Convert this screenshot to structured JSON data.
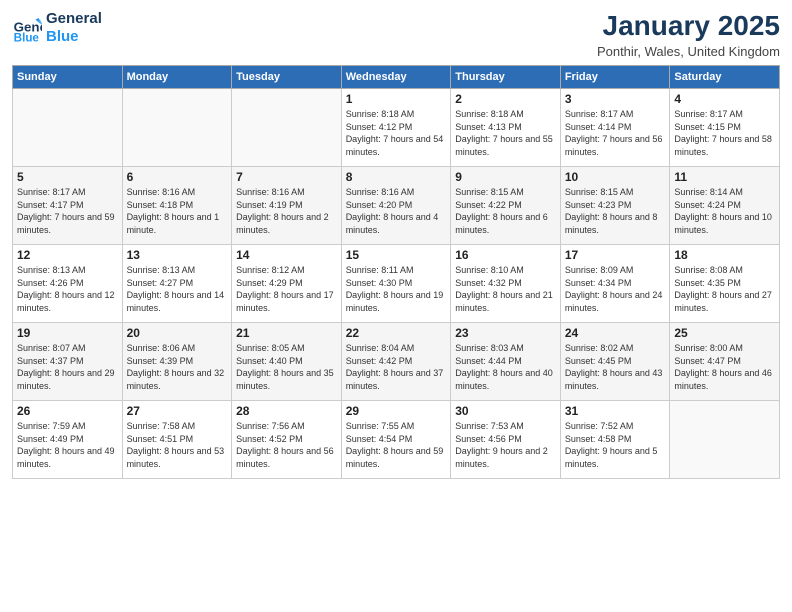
{
  "logo": {
    "line1": "General",
    "line2": "Blue"
  },
  "title": "January 2025",
  "location": "Ponthir, Wales, United Kingdom",
  "days_of_week": [
    "Sunday",
    "Monday",
    "Tuesday",
    "Wednesday",
    "Thursday",
    "Friday",
    "Saturday"
  ],
  "weeks": [
    [
      {
        "day": "",
        "sunrise": "",
        "sunset": "",
        "daylight": ""
      },
      {
        "day": "",
        "sunrise": "",
        "sunset": "",
        "daylight": ""
      },
      {
        "day": "",
        "sunrise": "",
        "sunset": "",
        "daylight": ""
      },
      {
        "day": "1",
        "sunrise": "Sunrise: 8:18 AM",
        "sunset": "Sunset: 4:12 PM",
        "daylight": "Daylight: 7 hours and 54 minutes."
      },
      {
        "day": "2",
        "sunrise": "Sunrise: 8:18 AM",
        "sunset": "Sunset: 4:13 PM",
        "daylight": "Daylight: 7 hours and 55 minutes."
      },
      {
        "day": "3",
        "sunrise": "Sunrise: 8:17 AM",
        "sunset": "Sunset: 4:14 PM",
        "daylight": "Daylight: 7 hours and 56 minutes."
      },
      {
        "day": "4",
        "sunrise": "Sunrise: 8:17 AM",
        "sunset": "Sunset: 4:15 PM",
        "daylight": "Daylight: 7 hours and 58 minutes."
      }
    ],
    [
      {
        "day": "5",
        "sunrise": "Sunrise: 8:17 AM",
        "sunset": "Sunset: 4:17 PM",
        "daylight": "Daylight: 7 hours and 59 minutes."
      },
      {
        "day": "6",
        "sunrise": "Sunrise: 8:16 AM",
        "sunset": "Sunset: 4:18 PM",
        "daylight": "Daylight: 8 hours and 1 minute."
      },
      {
        "day": "7",
        "sunrise": "Sunrise: 8:16 AM",
        "sunset": "Sunset: 4:19 PM",
        "daylight": "Daylight: 8 hours and 2 minutes."
      },
      {
        "day": "8",
        "sunrise": "Sunrise: 8:16 AM",
        "sunset": "Sunset: 4:20 PM",
        "daylight": "Daylight: 8 hours and 4 minutes."
      },
      {
        "day": "9",
        "sunrise": "Sunrise: 8:15 AM",
        "sunset": "Sunset: 4:22 PM",
        "daylight": "Daylight: 8 hours and 6 minutes."
      },
      {
        "day": "10",
        "sunrise": "Sunrise: 8:15 AM",
        "sunset": "Sunset: 4:23 PM",
        "daylight": "Daylight: 8 hours and 8 minutes."
      },
      {
        "day": "11",
        "sunrise": "Sunrise: 8:14 AM",
        "sunset": "Sunset: 4:24 PM",
        "daylight": "Daylight: 8 hours and 10 minutes."
      }
    ],
    [
      {
        "day": "12",
        "sunrise": "Sunrise: 8:13 AM",
        "sunset": "Sunset: 4:26 PM",
        "daylight": "Daylight: 8 hours and 12 minutes."
      },
      {
        "day": "13",
        "sunrise": "Sunrise: 8:13 AM",
        "sunset": "Sunset: 4:27 PM",
        "daylight": "Daylight: 8 hours and 14 minutes."
      },
      {
        "day": "14",
        "sunrise": "Sunrise: 8:12 AM",
        "sunset": "Sunset: 4:29 PM",
        "daylight": "Daylight: 8 hours and 17 minutes."
      },
      {
        "day": "15",
        "sunrise": "Sunrise: 8:11 AM",
        "sunset": "Sunset: 4:30 PM",
        "daylight": "Daylight: 8 hours and 19 minutes."
      },
      {
        "day": "16",
        "sunrise": "Sunrise: 8:10 AM",
        "sunset": "Sunset: 4:32 PM",
        "daylight": "Daylight: 8 hours and 21 minutes."
      },
      {
        "day": "17",
        "sunrise": "Sunrise: 8:09 AM",
        "sunset": "Sunset: 4:34 PM",
        "daylight": "Daylight: 8 hours and 24 minutes."
      },
      {
        "day": "18",
        "sunrise": "Sunrise: 8:08 AM",
        "sunset": "Sunset: 4:35 PM",
        "daylight": "Daylight: 8 hours and 27 minutes."
      }
    ],
    [
      {
        "day": "19",
        "sunrise": "Sunrise: 8:07 AM",
        "sunset": "Sunset: 4:37 PM",
        "daylight": "Daylight: 8 hours and 29 minutes."
      },
      {
        "day": "20",
        "sunrise": "Sunrise: 8:06 AM",
        "sunset": "Sunset: 4:39 PM",
        "daylight": "Daylight: 8 hours and 32 minutes."
      },
      {
        "day": "21",
        "sunrise": "Sunrise: 8:05 AM",
        "sunset": "Sunset: 4:40 PM",
        "daylight": "Daylight: 8 hours and 35 minutes."
      },
      {
        "day": "22",
        "sunrise": "Sunrise: 8:04 AM",
        "sunset": "Sunset: 4:42 PM",
        "daylight": "Daylight: 8 hours and 37 minutes."
      },
      {
        "day": "23",
        "sunrise": "Sunrise: 8:03 AM",
        "sunset": "Sunset: 4:44 PM",
        "daylight": "Daylight: 8 hours and 40 minutes."
      },
      {
        "day": "24",
        "sunrise": "Sunrise: 8:02 AM",
        "sunset": "Sunset: 4:45 PM",
        "daylight": "Daylight: 8 hours and 43 minutes."
      },
      {
        "day": "25",
        "sunrise": "Sunrise: 8:00 AM",
        "sunset": "Sunset: 4:47 PM",
        "daylight": "Daylight: 8 hours and 46 minutes."
      }
    ],
    [
      {
        "day": "26",
        "sunrise": "Sunrise: 7:59 AM",
        "sunset": "Sunset: 4:49 PM",
        "daylight": "Daylight: 8 hours and 49 minutes."
      },
      {
        "day": "27",
        "sunrise": "Sunrise: 7:58 AM",
        "sunset": "Sunset: 4:51 PM",
        "daylight": "Daylight: 8 hours and 53 minutes."
      },
      {
        "day": "28",
        "sunrise": "Sunrise: 7:56 AM",
        "sunset": "Sunset: 4:52 PM",
        "daylight": "Daylight: 8 hours and 56 minutes."
      },
      {
        "day": "29",
        "sunrise": "Sunrise: 7:55 AM",
        "sunset": "Sunset: 4:54 PM",
        "daylight": "Daylight: 8 hours and 59 minutes."
      },
      {
        "day": "30",
        "sunrise": "Sunrise: 7:53 AM",
        "sunset": "Sunset: 4:56 PM",
        "daylight": "Daylight: 9 hours and 2 minutes."
      },
      {
        "day": "31",
        "sunrise": "Sunrise: 7:52 AM",
        "sunset": "Sunset: 4:58 PM",
        "daylight": "Daylight: 9 hours and 5 minutes."
      },
      {
        "day": "",
        "sunrise": "",
        "sunset": "",
        "daylight": ""
      }
    ]
  ]
}
